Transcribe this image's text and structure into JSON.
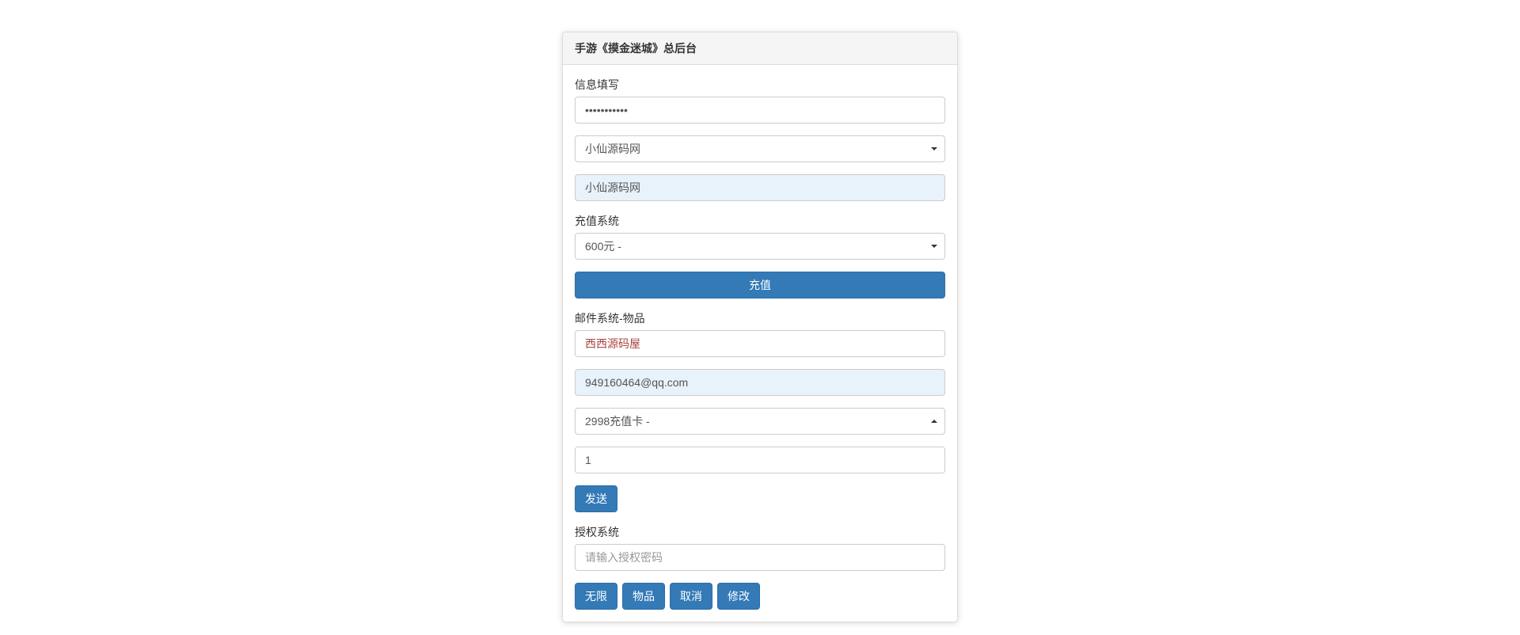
{
  "panel": {
    "title": "手游《摸金迷城》总后台"
  },
  "info_section": {
    "label": "信息填写",
    "password_value": "•••••••••••",
    "select1_value": "小仙源码网",
    "readonly_value": "小仙源码网"
  },
  "recharge_section": {
    "label": "充值系统",
    "select_value": "600元 -",
    "button_label": "充值"
  },
  "mail_section": {
    "label": "邮件系统-物品",
    "sender_value": "西西源码屋",
    "email_value": "949160464@qq.com",
    "item_select_value": "2998充值卡 -",
    "quantity_value": "1",
    "send_button_label": "发送"
  },
  "auth_section": {
    "label": "授权系统",
    "password_placeholder": "请输入授权密码",
    "buttons": {
      "unlimited": "无限",
      "item": "物品",
      "cancel": "取消",
      "modify": "修改"
    }
  }
}
